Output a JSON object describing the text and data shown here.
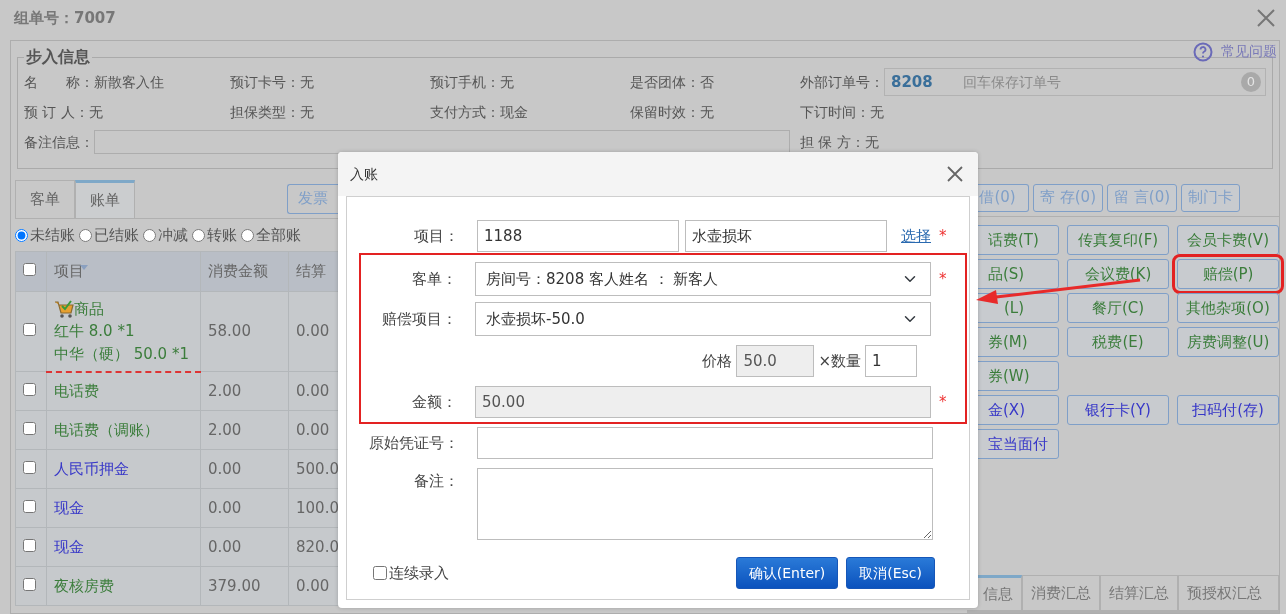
{
  "window": {
    "title": "组单号：7007"
  },
  "help_link": "常见问题",
  "info": {
    "legend": "步入信息",
    "rows": [
      [
        {
          "label": "名　　称：",
          "value": "新散客入住"
        },
        {
          "label": "预订卡号：",
          "value": "无"
        },
        {
          "label": "预订手机：",
          "value": "无"
        },
        {
          "label": "是否团体：",
          "value": "否"
        }
      ],
      [
        {
          "label": "预 订 人：",
          "value": "无"
        },
        {
          "label": "担保类型：",
          "value": "无"
        },
        {
          "label": "支付方式：",
          "value": "现金"
        },
        {
          "label": "保留时效：",
          "value": "无"
        },
        {
          "label": "下订时间：",
          "value": "无"
        }
      ]
    ],
    "external_order": {
      "label": "外部订单号：",
      "value": "8208",
      "placeholder": "回车保存订单号",
      "count": "0"
    },
    "remarks": {
      "label": "备注信息："
    },
    "guarantor": {
      "label": "担 保 方：",
      "value": "无"
    }
  },
  "tabs": [
    {
      "label": "客单",
      "selected": false
    },
    {
      "label": "账单",
      "selected": true
    }
  ],
  "invoice_button": "发票",
  "filters": [
    {
      "label": "未结账",
      "selected": true
    },
    {
      "label": "已结账",
      "selected": false
    },
    {
      "label": "冲减",
      "selected": false
    },
    {
      "label": "转账",
      "selected": false
    },
    {
      "label": "全部账",
      "selected": false
    }
  ],
  "table": {
    "header_checked": false,
    "columns": [
      "项目",
      "消费金额",
      "结算"
    ],
    "rows": [
      {
        "kind": "goods",
        "item": "商品",
        "lines": [
          "红牛 8.0 *1",
          "中华（硬） 50.0 *1"
        ],
        "amount": "58.00",
        "settled": "0.00",
        "checked": false
      },
      {
        "kind": "charge",
        "item": "电话费",
        "amount": "2.00",
        "settled": "0.00",
        "checked": false
      },
      {
        "kind": "charge",
        "item": "电话费（调账）",
        "amount": "2.00",
        "settled": "0.00",
        "checked": false
      },
      {
        "kind": "payment",
        "item": "人民币押金",
        "amount": "0.00",
        "settled": "500.0",
        "checked": false
      },
      {
        "kind": "payment",
        "item": "现金",
        "amount": "0.00",
        "settled": "100.0",
        "checked": false
      },
      {
        "kind": "payment",
        "item": "现金",
        "amount": "0.00",
        "settled": "820.0",
        "checked": false
      },
      {
        "kind": "charge",
        "item": "夜核房费",
        "amount": "379.00",
        "settled": "0.00",
        "checked": false
      }
    ]
  },
  "top_buttons": [
    "借(0)",
    "寄 存(0)",
    "留 言(0)",
    "制门卡"
  ],
  "action_rows": [
    [
      {
        "label": "话费(T)",
        "kind": "charge",
        "highlighted": false
      },
      {
        "label": "传真复印(F)",
        "kind": "charge",
        "highlighted": false
      },
      {
        "label": "会员卡费(V)",
        "kind": "charge",
        "highlighted": false
      }
    ],
    [
      {
        "label": "品(S)",
        "kind": "charge",
        "highlighted": false
      },
      {
        "label": "会议费(K)",
        "kind": "charge",
        "highlighted": false
      },
      {
        "label": "赔偿(P)",
        "kind": "charge",
        "highlighted": true
      }
    ],
    [
      {
        "label": "(L)",
        "kind": "charge",
        "highlighted": false
      },
      {
        "label": "餐厅(C)",
        "kind": "charge",
        "highlighted": false
      },
      {
        "label": "其他杂项(O)",
        "kind": "charge",
        "highlighted": false
      }
    ],
    [
      {
        "label": "券(M)",
        "kind": "charge",
        "highlighted": false
      },
      {
        "label": "税费(E)",
        "kind": "charge",
        "highlighted": false
      },
      {
        "label": "房费调整(U)",
        "kind": "charge",
        "highlighted": false
      }
    ],
    [
      {
        "label": "券(W)",
        "kind": "charge",
        "highlighted": false
      }
    ],
    [
      {
        "label": "金(X)",
        "kind": "payment",
        "highlighted": false
      },
      {
        "label": "银行卡(Y)",
        "kind": "payment",
        "highlighted": false
      },
      {
        "label": "扫码付(存)",
        "kind": "payment",
        "highlighted": false
      }
    ],
    [
      {
        "label": "宝当面付",
        "kind": "payment",
        "highlighted": false
      }
    ]
  ],
  "bottom_tabs": [
    {
      "label": "信息",
      "selected": true
    },
    {
      "label": "消费汇总",
      "selected": false
    },
    {
      "label": "结算汇总",
      "selected": false
    },
    {
      "label": "预授权汇总",
      "selected": false
    }
  ],
  "dialog": {
    "title": "入账",
    "item": {
      "label": "项目：",
      "code": "1188",
      "name": "水壶损坏",
      "link": "选择",
      "mark": "*"
    },
    "guest": {
      "label": "客单：",
      "value": "房间号：8208 客人姓名 ： 新客人",
      "mark": "*"
    },
    "compensation": {
      "label": "赔偿项目：",
      "value": "水壶损坏-50.0"
    },
    "price": {
      "label": "价格",
      "value": "50.0"
    },
    "quantity": {
      "label": "×数量",
      "value": "1"
    },
    "amount": {
      "label": "金额：",
      "value": "50.00",
      "mark": "*"
    },
    "voucher": {
      "label": "原始凭证号："
    },
    "remarks": {
      "label": "备注："
    },
    "continuous": {
      "label": "连续录入",
      "checked": false
    },
    "buttons": [
      "确认(Enter)",
      "取消(Esc)"
    ]
  }
}
